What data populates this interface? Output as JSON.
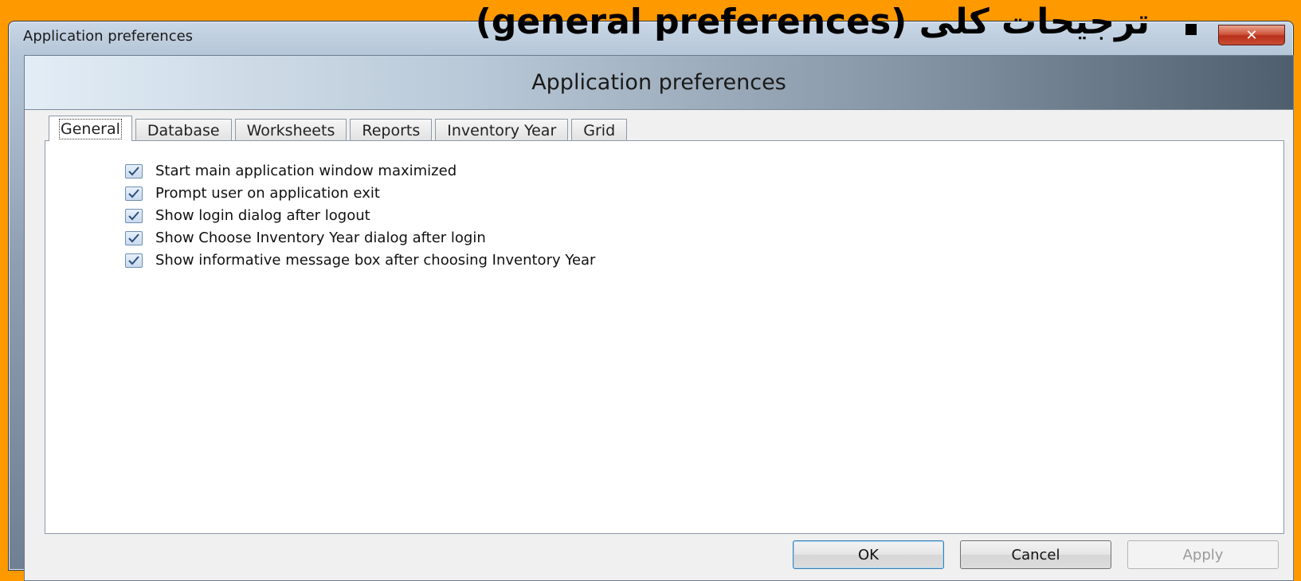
{
  "window": {
    "title": "Application preferences",
    "close_glyph": "✕"
  },
  "slide": {
    "heading": "ترجیحات کلی (general preferences)"
  },
  "banner": {
    "title": "Application preferences"
  },
  "tabs": [
    {
      "label": "General",
      "active": true
    },
    {
      "label": "Database"
    },
    {
      "label": "Worksheets"
    },
    {
      "label": "Reports"
    },
    {
      "label": "Inventory Year"
    },
    {
      "label": "Grid"
    }
  ],
  "general": {
    "options": [
      {
        "label": "Start main application window maximized",
        "checked": true
      },
      {
        "label": "Prompt user on application exit",
        "checked": true
      },
      {
        "label": "Show login dialog after logout",
        "checked": true
      },
      {
        "label": "Show Choose Inventory Year dialog after login",
        "checked": true
      },
      {
        "label": "Show informative message box after choosing Inventory Year",
        "checked": true
      }
    ]
  },
  "buttons": {
    "ok": "OK",
    "cancel": "Cancel",
    "apply": "Apply"
  },
  "colors": {
    "slide_background": "#ff9900",
    "default_button_border": "#3c7fb1"
  }
}
